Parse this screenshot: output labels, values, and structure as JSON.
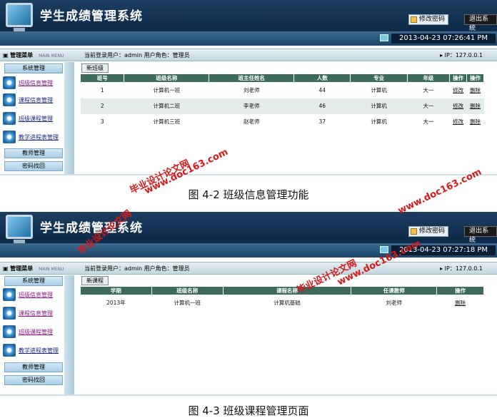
{
  "app_title": "学生成绩管理系统",
  "change_pwd": "修改密码",
  "logout": "退出系统",
  "menu_title": "管理菜单",
  "menu_en": "MAIN MENU",
  "login_info": "当前登录用户：admin 用户角色：管理员",
  "ip": "IP：127.0.0.1",
  "sidebar": {
    "system": "系统管理",
    "items": [
      "班级信息管理",
      "课程信息管理",
      "班级课程管理",
      "教学进程表管理"
    ],
    "teacher": "教师管理",
    "pwd": "密码找回"
  },
  "shot1": {
    "time": "2013-04-23 07:26:41 PM",
    "new_button": "新班级",
    "headers": [
      "班号",
      "班级名称",
      "班主任姓名",
      "人数",
      "专业",
      "年级",
      "操作",
      "操作"
    ],
    "rows": [
      [
        "1",
        "计算机一班",
        "刘老师",
        "44",
        "计算机",
        "大一",
        "修改",
        "删除"
      ],
      [
        "2",
        "计算机二班",
        "李老师",
        "46",
        "计算机",
        "大一",
        "修改",
        "删除"
      ],
      [
        "3",
        "计算机三班",
        "赵老师",
        "37",
        "计算机",
        "大一",
        "修改",
        "删除"
      ]
    ],
    "caption": "图 4-2 班级信息管理功能"
  },
  "shot2": {
    "time": "2013-04-23 07:27:18 PM",
    "new_button": "新课程",
    "headers": [
      "学期",
      "班级名称",
      "课程名称",
      "任课教师",
      "操作"
    ],
    "rows": [
      [
        "2013年",
        "计算机一班",
        "计算机基础",
        "刘老师",
        "删除"
      ]
    ],
    "caption": "图 4-3 班级课程管理页面"
  },
  "watermark": {
    "site_cn": "毕业设计论文网",
    "site_url": "www.doc163.com"
  }
}
